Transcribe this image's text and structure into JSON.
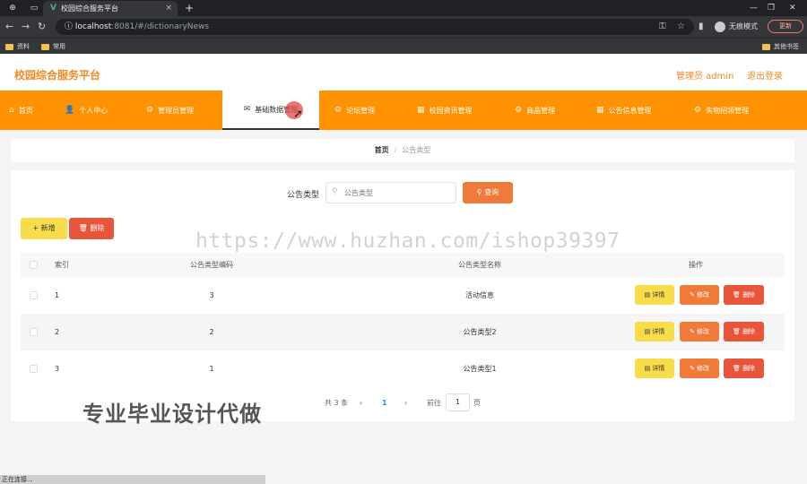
{
  "browser": {
    "tab_title": "校园综合服务平台",
    "tab_close": "×",
    "new_tab": "+",
    "url_host": "localhost",
    "url_path": ":8081/#/dictionaryNews",
    "incognito_label": "无痕模式",
    "update_button": "更新",
    "bookmarks": [
      "资料",
      "常用"
    ],
    "other_bookmarks": "其他书签"
  },
  "header": {
    "title": "校园综合服务平台",
    "user": "管理员 admin",
    "logout": "退出登录"
  },
  "nav": {
    "items": [
      {
        "label": "首页",
        "icon": "⌂"
      },
      {
        "label": "个人中心",
        "icon": "👤"
      },
      {
        "label": "管理员管理",
        "icon": "⚙"
      },
      {
        "label": "基础数据管理",
        "icon": "✉"
      },
      {
        "label": "论坛管理",
        "icon": "⚙"
      },
      {
        "label": "校园资讯管理",
        "icon": "▦"
      },
      {
        "label": "商品管理",
        "icon": "⚙"
      },
      {
        "label": "公告信息管理",
        "icon": "▦"
      },
      {
        "label": "失物招领管理",
        "icon": "⚙"
      }
    ],
    "active_index": 3
  },
  "breadcrumb": {
    "home": "首页",
    "separator": "/",
    "current": "公告类型"
  },
  "search": {
    "label": "公告类型",
    "placeholder": "公告类型",
    "button": "查询"
  },
  "actions": {
    "add": "新增",
    "delete": "删除"
  },
  "table": {
    "headers": [
      "索引",
      "公告类型编码",
      "公告类型名称",
      "操作"
    ],
    "rows": [
      {
        "index": "1",
        "code": "3",
        "name": "活动信息"
      },
      {
        "index": "2",
        "code": "2",
        "name": "公告类型2"
      },
      {
        "index": "3",
        "code": "1",
        "name": "公告类型1"
      }
    ],
    "row_actions": {
      "detail": "详情",
      "edit": "修改",
      "delete": "删除"
    }
  },
  "pagination": {
    "total": "共 3 条",
    "prev": "‹",
    "current": "1",
    "next": "›",
    "goto": "前往",
    "page_input": "1",
    "page_unit": "页"
  },
  "watermark": "https://www.huzhan.com/ishop39397",
  "promo_text": "专业毕业设计代做",
  "status_text": "正在连接..."
}
